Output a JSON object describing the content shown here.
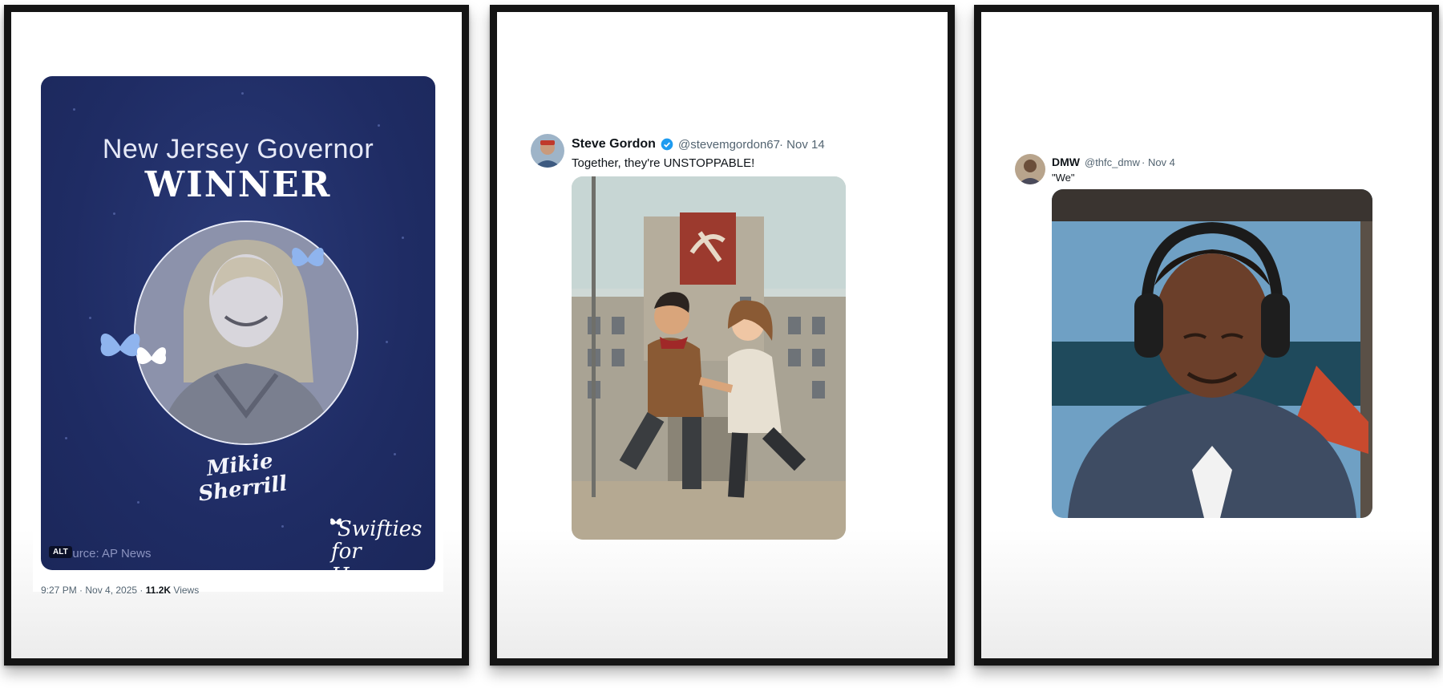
{
  "frames": [
    {
      "poster": {
        "heading": "New Jersey Governor",
        "subheading": "WINNER",
        "name": "Mikie Sherrill",
        "source": "Source: AP News",
        "alt_badge": "ALT",
        "logo_line1": "Swifties",
        "logo_line2": "for Hope",
        "butterfly_color": "#8fb4ee"
      },
      "tweet_meta": {
        "time": "9:27 PM · Nov 4, 2025 · ",
        "views_count": "11.2K",
        "views_label": " Views"
      }
    },
    {
      "tweet": {
        "display_name": "Steve Gordon",
        "handle": "@stevemgordon67",
        "date": "· Nov 14",
        "text": "Together, they're UNSTOPPABLE!",
        "verified": true,
        "media_icon": "hammer-and-sickle-banner"
      }
    },
    {
      "tweet": {
        "display_name": "DMW",
        "handle": "@thfc_dmw",
        "date": "· Nov 4",
        "text": "\"We\""
      }
    }
  ],
  "colors": {
    "poster_bg": "#1f2c64",
    "verified_blue": "#1d9bf0",
    "frame": "#141414"
  }
}
